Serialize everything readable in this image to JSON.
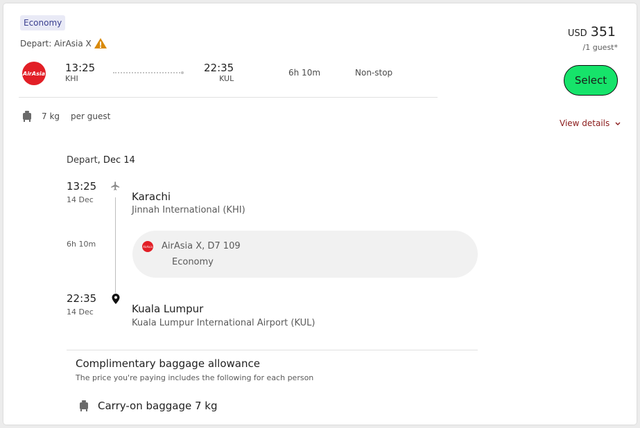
{
  "badge": "Economy",
  "depart_label": "Depart: AirAsia X",
  "airline_logo_text": "AirAsia",
  "flight": {
    "dep_time": "13:25",
    "dep_code": "KHI",
    "arr_time": "22:35",
    "arr_code": "KUL",
    "duration": "6h 10m",
    "stops": "Non-stop"
  },
  "baggage_summary": {
    "weight": "7 kg",
    "per": "per guest"
  },
  "price": {
    "currency": "USD",
    "amount": "351",
    "per_guest": "/1 guest*"
  },
  "select_label": "Select",
  "view_details_label": "View details",
  "details": {
    "header_prefix": "Depart",
    "header_date": ", Dec 14",
    "dep_time": "13:25",
    "dep_date": "14 Dec",
    "dep_city": "Karachi",
    "dep_airport": "Jinnah International (KHI)",
    "duration": "6h 10m",
    "segment_flight": "AirAsia X, D7 109",
    "segment_class": "Economy",
    "arr_time": "22:35",
    "arr_date": "14 Dec",
    "arr_city": "Kuala Lumpur",
    "arr_airport": "Kuala Lumpur International Airport (KUL)"
  },
  "allowance": {
    "title": "Complimentary baggage allowance",
    "subtitle": "The price you're paying includes the following for each person",
    "item": "Carry-on baggage 7 kg"
  },
  "colors": {
    "select_bg": "#16e36a",
    "airline_red": "#e21f26",
    "view_details": "#8a1a1a"
  }
}
